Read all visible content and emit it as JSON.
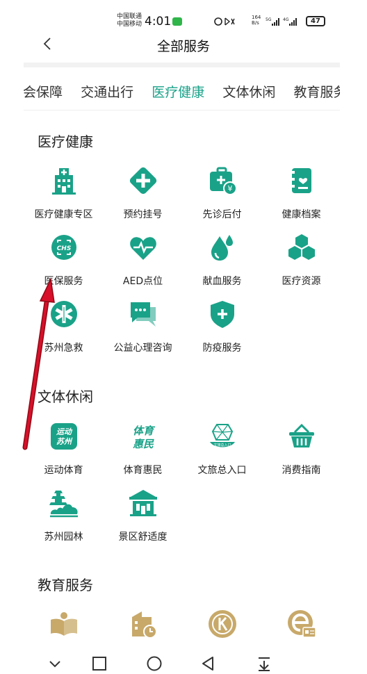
{
  "status": {
    "carrier1": "中国联通",
    "carrier2": "中国移动",
    "time": "4:01",
    "speed_value": "164",
    "speed_unit": "B/s",
    "battery": "47"
  },
  "header": {
    "title": "全部服务"
  },
  "tabs": [
    "社会保障",
    "交通出行",
    "医疗健康",
    "文体休闲",
    "教育服务"
  ],
  "active_tab": "医疗健康",
  "colors": {
    "accent": "#1aa288",
    "education_gold": "#c8a96a",
    "arrow_red": "#d8102a"
  },
  "sections": [
    {
      "title": "医疗健康",
      "items": [
        {
          "label": "医疗健康专区",
          "icon": "hospital-icon"
        },
        {
          "label": "预约挂号",
          "icon": "medical-cross-icon"
        },
        {
          "label": "先诊后付",
          "icon": "medical-kit-payment-icon"
        },
        {
          "label": "健康档案",
          "icon": "health-record-icon"
        },
        {
          "label": "医保服务",
          "icon": "chs-insurance-icon"
        },
        {
          "label": "AED点位",
          "icon": "heart-pulse-icon"
        },
        {
          "label": "献血服务",
          "icon": "blood-drop-icon"
        },
        {
          "label": "医疗资源",
          "icon": "cubes-icon"
        },
        {
          "label": "苏州急救",
          "icon": "star-of-life-icon"
        },
        {
          "label": "公益心理咨询",
          "icon": "chat-bubbles-icon"
        },
        {
          "label": "防疫服务",
          "icon": "shield-plus-icon"
        }
      ]
    },
    {
      "title": "文体休闲",
      "items": [
        {
          "label": "运动体育",
          "icon": "suzhou-sports-logo-icon",
          "logo_text": "运动苏州"
        },
        {
          "label": "体育惠民",
          "icon": "sports-benefit-logo-icon",
          "logo_text": "体育惠民"
        },
        {
          "label": "文旅总入口",
          "icon": "culture-tourism-icon",
          "logo_text": "文旅总入口"
        },
        {
          "label": "消费指南",
          "icon": "shopping-basket-icon"
        },
        {
          "label": "苏州园林",
          "icon": "pagoda-garden-icon"
        },
        {
          "label": "景区舒适度",
          "icon": "gate-pavilion-icon"
        }
      ]
    },
    {
      "title": "教育服务",
      "items": [
        {
          "label": "",
          "icon": "open-book-person-icon"
        },
        {
          "label": "",
          "icon": "building-clock-icon"
        },
        {
          "label": "",
          "icon": "k-circle-icon"
        },
        {
          "label": "",
          "icon": "e-card-icon"
        }
      ]
    }
  ]
}
